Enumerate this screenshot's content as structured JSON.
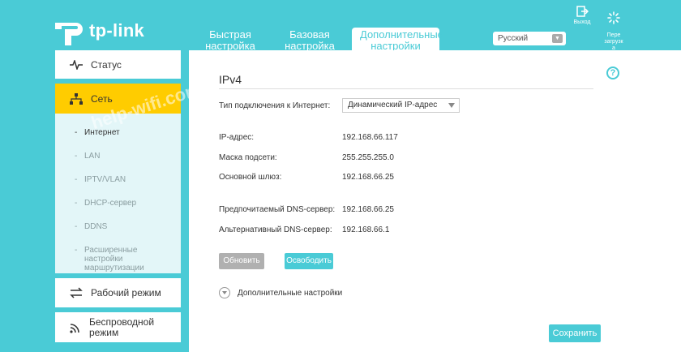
{
  "header": {
    "logo_text": "tp-link",
    "tabs": [
      {
        "label": "Быстрая\nнастройка"
      },
      {
        "label": "Базовая\nнастройка"
      },
      {
        "label": "Дополнительные\nнастройки"
      }
    ],
    "language": "Русский",
    "logout_label": "Выход",
    "reboot_label": "Пере\nзагрузк\nа"
  },
  "sidebar": {
    "items": [
      {
        "label": "Статус"
      },
      {
        "label": "Сеть"
      },
      {
        "label": "Рабочий режим"
      },
      {
        "label": "Беспроводной\nрежим"
      }
    ],
    "sub": [
      {
        "label": "Интернет"
      },
      {
        "label": "LAN"
      },
      {
        "label": "IPTV/VLAN"
      },
      {
        "label": "DHCP-сервер"
      },
      {
        "label": "DDNS"
      },
      {
        "label": "Расширенные\nнастройки\nмаршрутизации"
      }
    ]
  },
  "main": {
    "section_title": "IPv4",
    "connection_type_label": "Тип подключения к Интернет:",
    "connection_type_value": "Динамический IP-адрес",
    "fields": [
      {
        "label": "IP-адрес:",
        "value": "192.168.66.117"
      },
      {
        "label": "Маска подсети:",
        "value": "255.255.255.0"
      },
      {
        "label": "Основной шлюз:",
        "value": "192.168.66.25"
      },
      {
        "label": "Предпочитаемый DNS-сервер:",
        "value": "192.168.66.25"
      },
      {
        "label": "Альтернативный DNS-сервер:",
        "value": "192.168.66.1"
      }
    ],
    "renew_label": "Обновить",
    "release_label": "Освободить",
    "advanced_label": "Дополнительные настройки",
    "save_label": "Сохранить",
    "help_icon": "?"
  },
  "watermark": "help-wifi.com",
  "colors": {
    "accent": "#4acbd6",
    "active_nav": "#ffcc00"
  }
}
